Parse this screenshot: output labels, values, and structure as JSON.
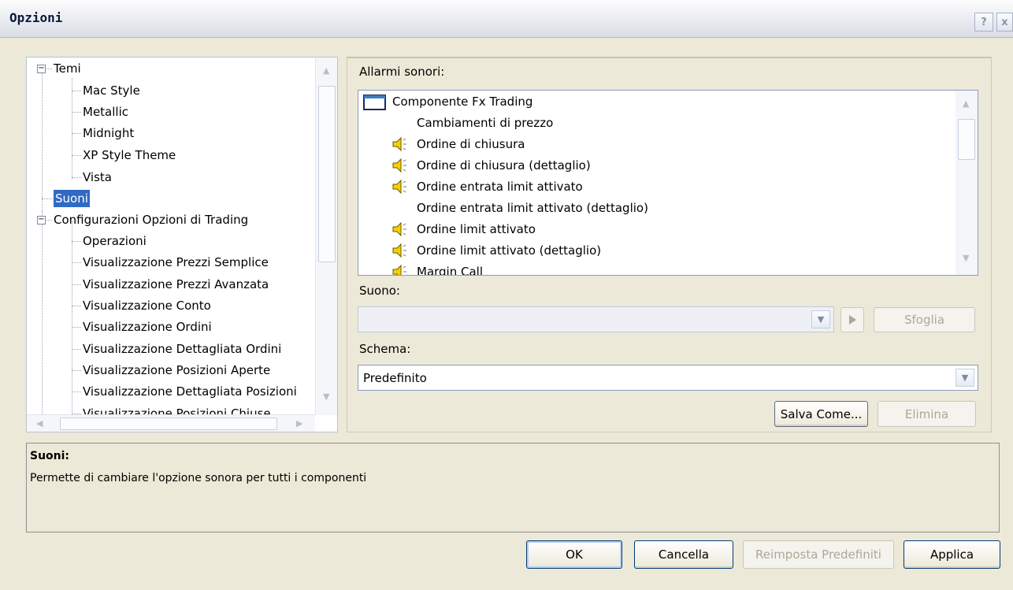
{
  "window": {
    "title": "Opzioni",
    "help_label": "?",
    "close_label": "x"
  },
  "tree": {
    "items": [
      {
        "label": "Temi",
        "expander": "−"
      },
      {
        "label": "Mac Style"
      },
      {
        "label": "Metallic"
      },
      {
        "label": "Midnight"
      },
      {
        "label": "XP Style Theme"
      },
      {
        "label": "Vista"
      },
      {
        "label": "Suoni",
        "selected": true
      },
      {
        "label": "Configurazioni Opzioni di Trading",
        "expander": "−"
      },
      {
        "label": "Operazioni"
      },
      {
        "label": "Visualizzazione Prezzi Semplice"
      },
      {
        "label": "Visualizzazione Prezzi Avanzata"
      },
      {
        "label": "Visualizzazione Conto"
      },
      {
        "label": "Visualizzazione Ordini"
      },
      {
        "label": "Visualizzazione Dettagliata Ordini"
      },
      {
        "label": "Visualizzazione Posizioni Aperte"
      },
      {
        "label": "Visualizzazione Dettagliata Posizioni"
      },
      {
        "label": "Visualizzazione Posizioni Chiuse"
      }
    ]
  },
  "sounds": {
    "section_label": "Allarmi sonori:",
    "items": [
      {
        "label": "Componente Fx Trading",
        "icon": "window-icon"
      },
      {
        "label": "Cambiamenti di prezzo",
        "icon": ""
      },
      {
        "label": "Ordine di chiusura",
        "icon": "speaker-icon"
      },
      {
        "label": "Ordine di chiusura (dettaglio)",
        "icon": "speaker-icon"
      },
      {
        "label": "Ordine entrata limit attivato",
        "icon": "speaker-icon"
      },
      {
        "label": "Ordine entrata limit attivato (dettaglio)",
        "icon": ""
      },
      {
        "label": "Ordine limit attivato",
        "icon": "speaker-icon"
      },
      {
        "label": "Ordine limit attivato (dettaglio)",
        "icon": "speaker-icon"
      },
      {
        "label": "Margin Call",
        "icon": "speaker-icon"
      }
    ],
    "sound_label": "Suono:",
    "sound_value": "",
    "browse_label": "Sfoglia",
    "scheme_label": "Schema:",
    "scheme_value": "Predefinito",
    "save_as_label": "Salva Come...",
    "delete_label": "Elimina"
  },
  "description": {
    "title": "Suoni:",
    "text": "Permette di cambiare l'opzione sonora per tutti i componenti"
  },
  "footer": {
    "ok_label": "OK",
    "cancel_label": "Cancella",
    "reset_label": "Reimposta Predefiniti",
    "apply_label": "Applica"
  },
  "colors": {
    "selection": "#316ac5",
    "dialog_bg": "#ece9d8"
  }
}
